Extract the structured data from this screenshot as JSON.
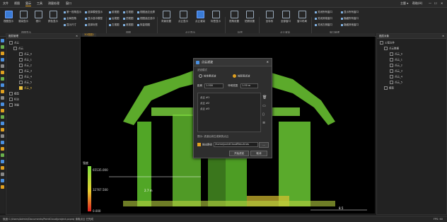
{
  "menubar": {
    "items": [
      "文件",
      "视图",
      "显示",
      "工具",
      "测量处理",
      "窗口"
    ],
    "active_index": 2,
    "right_label": "主题 ▾",
    "right_label_2": "帮助(H)",
    "window_controls": [
      "—",
      "☐",
      "✕"
    ]
  },
  "ribbon": {
    "big_buttons": [
      {
        "label": "视图显示",
        "icon": "view-icon"
      },
      {
        "label": "渲染显示",
        "icon": "render-icon"
      },
      {
        "label": "视口",
        "icon": "viewport-icon"
      },
      {
        "label": "颜色显示",
        "icon": "color-icon"
      },
      {
        "label": "背景设置",
        "icon": "background-icon"
      },
      {
        "label": "点云显示",
        "icon": "pointcloud-display-icon"
      },
      {
        "label": "点云渲染",
        "icon": "pointcloud-render-icon"
      },
      {
        "label": "标签显示",
        "icon": "label-icon"
      },
      {
        "label": "视角设置",
        "icon": "view-angle-icon"
      },
      {
        "label": "拍照设置",
        "icon": "snapshot-icon"
      },
      {
        "label": "坐标系",
        "icon": "coordinate-icon"
      },
      {
        "label": "全部窗口",
        "icon": "window-icon"
      },
      {
        "label": "窗口布局",
        "icon": "layout-icon"
      }
    ],
    "small_buttons": [
      "第一视角显示",
      "全局视角",
      "显示尺寸",
      "选择模型显示",
      "显示选中模型",
      "选择标签",
      "前视图",
      "后视图",
      "左视图",
      "右视图",
      "顶视图",
      "底视图",
      "视图适应全屏",
      "视图适应选中",
      "恢复视图",
      "关闭所有窗口",
      "关闭其他窗口",
      "关闭左侧窗口",
      "显示所有窗口",
      "隐藏所有窗口",
      "隐藏其他窗口"
    ],
    "groups": [
      "视图显示",
      "视图",
      "点云显示",
      "标签",
      "点云渲染",
      "窗口管理"
    ]
  },
  "left_panel": {
    "title": "图层管理",
    "tree": [
      {
        "label": "点云",
        "level": 0,
        "checked": true
      },
      {
        "label": "点云",
        "level": 1,
        "checked": true
      },
      {
        "label": "点云_0",
        "level": 2,
        "checked": true
      },
      {
        "label": "点云_1",
        "level": 2,
        "checked": true
      },
      {
        "label": "点云_2",
        "level": 2,
        "checked": true
      },
      {
        "label": "点云_3",
        "level": 2,
        "checked": true
      },
      {
        "label": "点云_4",
        "level": 2,
        "checked": true
      },
      {
        "label": "点云_5",
        "level": 2,
        "checked": true
      },
      {
        "label": "点云_6",
        "level": 2,
        "checked": true,
        "highlight": true
      },
      {
        "label": "模型",
        "level": 0,
        "checked": true
      },
      {
        "label": "标注",
        "level": 0,
        "checked": true
      },
      {
        "label": "测量",
        "level": 0,
        "checked": true
      }
    ]
  },
  "right_panel": {
    "title": "图层对象",
    "tree": [
      {
        "label": "工程文件",
        "level": 0
      },
      {
        "label": "点云数据",
        "level": 1
      },
      {
        "label": "点云_0",
        "level": 2
      },
      {
        "label": "点云_1",
        "level": 2
      },
      {
        "label": "点云_2",
        "level": 2
      },
      {
        "label": "点云_3",
        "level": 2
      },
      {
        "label": "点云_4",
        "level": 2
      },
      {
        "label": "点云_5",
        "level": 2
      },
      {
        "label": "模型",
        "level": 1
      }
    ]
  },
  "viewport": {
    "tab_label": "3D视图1",
    "legend_title": "强度",
    "legend_values": [
      "65535.000",
      "32767.500",
      "0.000"
    ],
    "scale_value": "8.5",
    "measure_label": "2.7 m"
  },
  "dialog": {
    "title": "点云滤波",
    "section_label": "滤波模式",
    "radio_options": [
      "按体素滤波",
      "按距离滤波"
    ],
    "selected_radio": 1,
    "field1_label": "距离",
    "field1_value": "1.000",
    "field2_label": "邻域范围",
    "field2_value": "1.00 m",
    "list_items": [
      "点云 #1",
      "点云 #2",
      "点云 #3"
    ],
    "hint_text": "提示: 滤波后将生成新的点云",
    "output_checkbox_label": "输出路径",
    "output_path": "/home/pointCloudResult.las",
    "browse_label": "...",
    "ok_label": "开始滤波",
    "cancel_label": "取消"
  },
  "statusbar": {
    "left_text": "就绪  C:/Users/Admin/Documents/PointCloud/project.pcproj  读取点云  已完成",
    "right_text": "FPS: 60"
  },
  "colors": {
    "accent": "#e0a020",
    "highlight_blue": "#3a7bd5",
    "legend_top": "#7ee040",
    "legend_mid": "#e8d030",
    "legend_bottom": "#e02020"
  }
}
